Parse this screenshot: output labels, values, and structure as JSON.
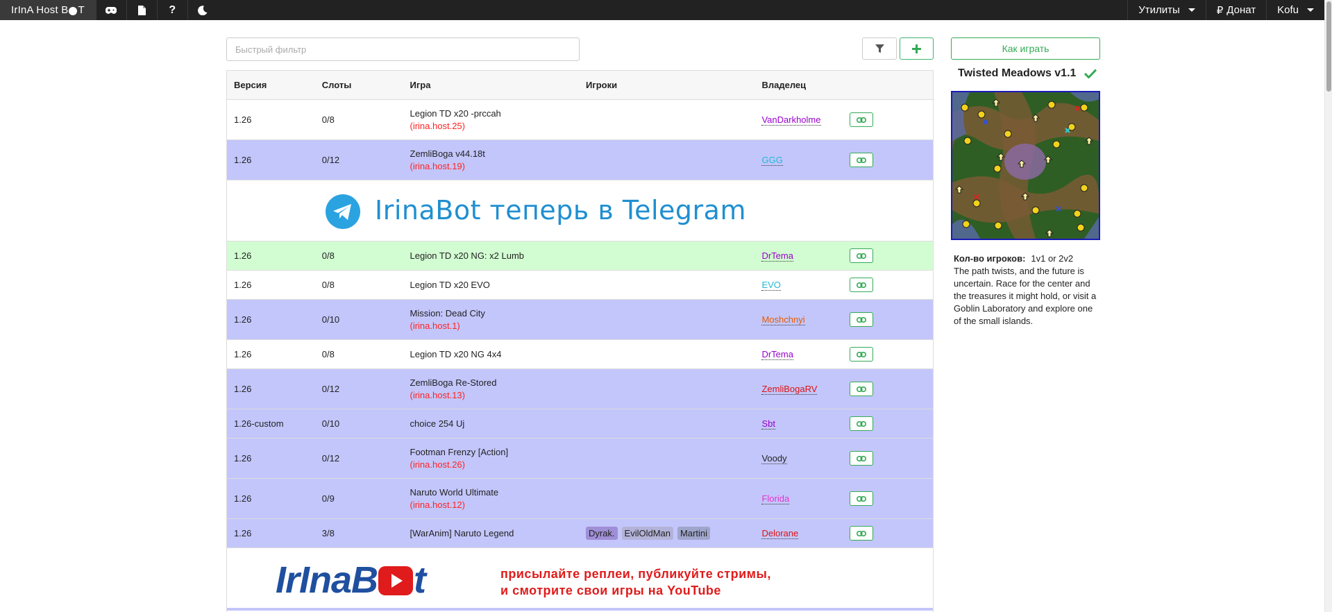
{
  "navbar": {
    "brand_pre": "IrInA Host B",
    "brand_post": "T",
    "icons": [
      "gamepad-icon",
      "file-icon",
      "question-icon",
      "moon-icon"
    ],
    "utilities": "Утилиты",
    "donate": "Донат",
    "user": "Kofu"
  },
  "filter": {
    "placeholder": "Быстрый фильтр"
  },
  "table": {
    "headers": {
      "version": "Версия",
      "slots": "Слоты",
      "game": "Игра",
      "players": "Игроки",
      "owner": "Владелец"
    },
    "rows": [
      {
        "version": "1.26",
        "slots": "0/8",
        "game": "Legion TD x20 -prccah",
        "host": "(irina.host.25)",
        "players": [],
        "owner": "VanDarkholme"
      },
      {
        "version": "1.26",
        "slots": "0/12",
        "game": "ZemliBoga v44.18t",
        "host": "(irina.host.19)",
        "players": [],
        "owner": "GGG"
      },
      {
        "version": "1.26",
        "slots": "0/8",
        "game": "Legion TD x20 NG: x2 Lumb",
        "host": "",
        "players": [],
        "owner": "DrTema"
      },
      {
        "version": "1.26",
        "slots": "0/8",
        "game": "Legion TD x20 EVO",
        "host": "",
        "players": [],
        "owner": "EVO"
      },
      {
        "version": "1.26",
        "slots": "0/10",
        "game": "Mission: Dead City",
        "host": "(irina.host.1)",
        "players": [],
        "owner": "Moshchnyi"
      },
      {
        "version": "1.26",
        "slots": "0/8",
        "game": "Legion TD x20 NG 4x4",
        "host": "",
        "players": [],
        "owner": "DrTema"
      },
      {
        "version": "1.26",
        "slots": "0/12",
        "game": "ZemliBoga Re-Stored",
        "host": "(irina.host.13)",
        "players": [],
        "owner": "ZemliBogaRV"
      },
      {
        "version": "1.26-custom",
        "slots": "0/10",
        "game": "choice 254 Uj",
        "host": "",
        "players": [],
        "owner": "Sbt"
      },
      {
        "version": "1.26",
        "slots": "0/12",
        "game": "Footman Frenzy [Action]",
        "host": "(irina.host.26)",
        "players": [],
        "owner": "Voody"
      },
      {
        "version": "1.26",
        "slots": "0/9",
        "game": "Naruto World Ultimate",
        "host": "(irina.host.12)",
        "players": [],
        "owner": "Florida"
      },
      {
        "version": "1.26",
        "slots": "3/8",
        "game": "[WarAnim] Naruto Legend",
        "host": "",
        "players": [
          "Dyrak.",
          "EvilOldMan",
          "Martini"
        ],
        "owner": "Delorane"
      }
    ]
  },
  "banners": {
    "telegram": "IrinaBot теперь в Telegram",
    "youtube_logo_pre": "IrInaB",
    "youtube_logo_post": "t",
    "youtube_line1": "присылайте реплеи, публикуйте стримы,",
    "youtube_line2": "и смотрите свои игры на YouTube"
  },
  "sidebar": {
    "how_to_play": "Как играть",
    "map_name": "Twisted Meadows v1.1",
    "players_label": "Кол-во игроков:",
    "players_value": "1v1 or 2v2",
    "description": "The path twists, and the future is uncertain. Race for the center and the treasures it might hold, or visit a Goblin Laboratory and explore one of the small islands."
  },
  "colors": {
    "accent": "#33aa55",
    "row_blue": "#c3c6fb",
    "row_green": "#d2fdd2",
    "navbar": "#222222",
    "host_red": "#ff2222"
  }
}
